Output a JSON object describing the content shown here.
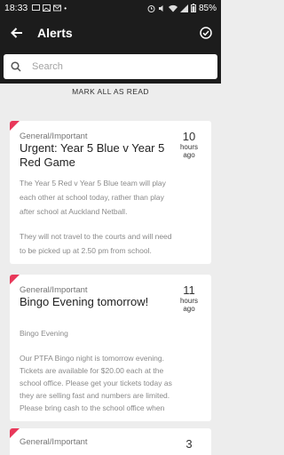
{
  "status_bar": {
    "time": "18:33",
    "battery": "85%"
  },
  "header": {
    "title": "Alerts"
  },
  "search": {
    "placeholder": "Search",
    "value": ""
  },
  "mark_all_label": "MARK ALL AS READ",
  "alerts": [
    {
      "category": "General/Important",
      "title_lines": [
        "Urgent: Year 5 Blue v Year 5",
        "Red Game"
      ],
      "ago_num": "10",
      "ago_lines": [
        "hours",
        "ago"
      ],
      "body_lines": [
        "The Year 5 Red v Year 5 Blue team will play",
        "each other at school today, rather than play",
        "after school at Auckland Netball.",
        "",
        "They will not travel to the courts and will need",
        "to be picked up at 2.50 pm from school."
      ]
    },
    {
      "category": "General/Important",
      "title_lines": [
        "Bingo Evening tomorrow!"
      ],
      "ago_num": "11",
      "ago_lines": [
        "hours",
        "ago"
      ],
      "subtitle": "Bingo Evening",
      "body_lines": [
        "Our PTFA Bingo night is tomorrow evening.",
        "Tickets are available for $20.00 each at the",
        "school office. Please get your tickets today as",
        "they are selling fast and numbers are limited.",
        "Please bring cash to the school office when"
      ]
    },
    {
      "category": "General/Important",
      "ago_num": "3"
    }
  ],
  "colors": {
    "appbar": "#1c1c1c",
    "unread_marker": "#e8385a",
    "background": "#ededed"
  }
}
